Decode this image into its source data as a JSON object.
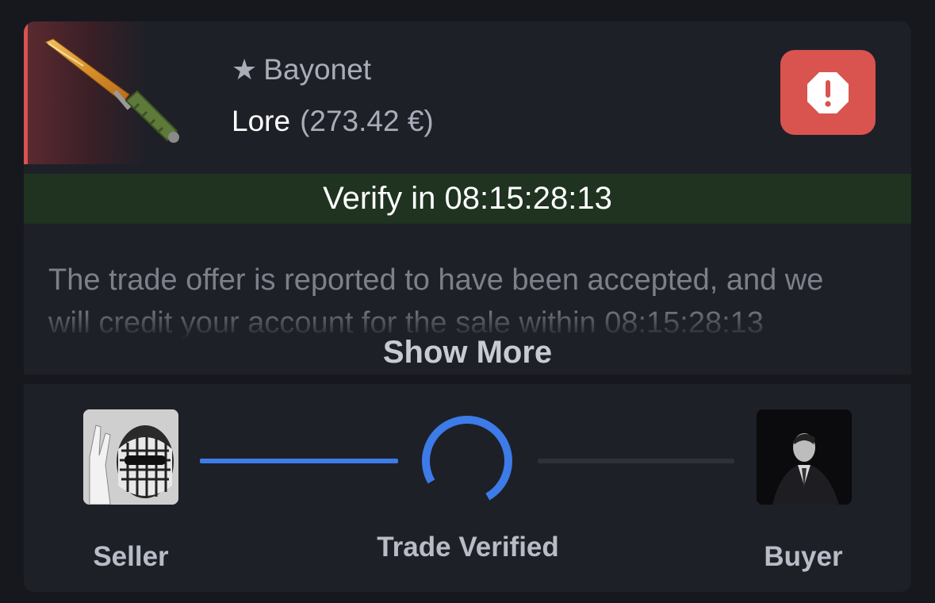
{
  "item": {
    "star": "★",
    "name": "Bayonet",
    "skin": "Lore",
    "price": "(273.42 €)",
    "rarity_color": "#d9534f"
  },
  "alert": {
    "icon": "alert-octagon-icon",
    "color": "#d9534f"
  },
  "verify": {
    "text": "Verify in 08:15:28:13",
    "background": "#1f3320"
  },
  "message": {
    "text": "The trade offer is reported to have been accepted, and we will credit your account for the sale within 08:15:28:13",
    "show_more_label": "Show More"
  },
  "trade": {
    "seller_label": "Seller",
    "status_label": "Trade Verified",
    "buyer_label": "Buyer",
    "accent_color": "#3d7be8"
  }
}
